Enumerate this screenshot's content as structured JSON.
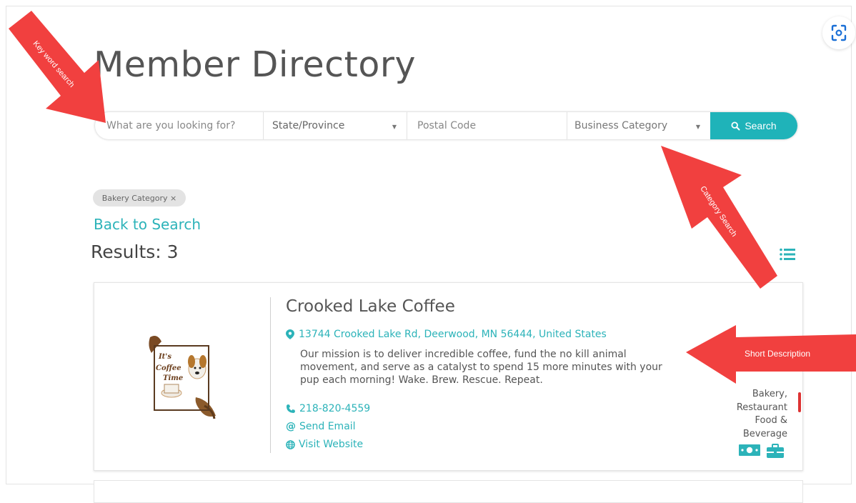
{
  "page": {
    "title": "Member Directory"
  },
  "search": {
    "keyword_placeholder": "What are you looking for?",
    "state_label": "State/Province",
    "postal_placeholder": "Postal Code",
    "category_label": "Business Category",
    "button_label": "Search"
  },
  "filters": {
    "active_chip": "Bakery Category ×"
  },
  "nav": {
    "back_label": "Back to Search"
  },
  "results": {
    "label": "Results: 3"
  },
  "listing": {
    "name": "Crooked Lake Coffee",
    "address": "13744 Crooked Lake Rd, Deerwood, MN 56444, United States",
    "description": "Our mission is to deliver incredible coffee, fund the no kill animal movement, and serve as a catalyst to spend 15 more minutes with your pup each morning! Wake. Brew. Rescue. Repeat.",
    "phone": "218-820-4559",
    "email_label": "Send Email",
    "website_label": "Visit Website",
    "categories": [
      "Bakery,",
      "Restaurant",
      "Food &",
      "Beverage"
    ],
    "logo_text": [
      "It's",
      "Coffee",
      "Time"
    ]
  },
  "annotations": {
    "keyword": "Key word search",
    "category": "Category Search",
    "description": "Short Description"
  },
  "colors": {
    "accent": "#1fb3b9",
    "annotation_red": "#f1403f"
  }
}
